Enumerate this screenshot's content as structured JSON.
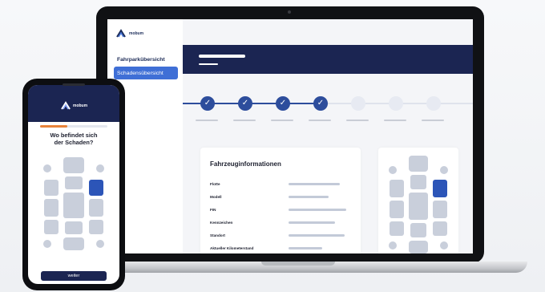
{
  "laptop": {
    "logo_text": "mobum",
    "sidebar": {
      "items": [
        {
          "label": "Fahrparkübersicht",
          "active": false
        },
        {
          "label": "Schadensübersicht",
          "active": true
        }
      ]
    },
    "stepper": {
      "steps": [
        {
          "state": "done",
          "glyph": "✓"
        },
        {
          "state": "done",
          "glyph": "✓"
        },
        {
          "state": "done",
          "glyph": "✓"
        },
        {
          "state": "done",
          "glyph": "✓"
        },
        {
          "state": "todo",
          "glyph": ""
        },
        {
          "state": "todo",
          "glyph": ""
        },
        {
          "state": "todo",
          "glyph": ""
        }
      ]
    },
    "vehicle_card": {
      "title": "Fahrzeuginformationen",
      "fields": [
        {
          "label": "Flotte"
        },
        {
          "label": "Modell"
        },
        {
          "label": "FIN"
        },
        {
          "label": "Kennzeichen"
        },
        {
          "label": "Standort"
        },
        {
          "label": "Aktueller Kilometerstand"
        }
      ]
    }
  },
  "phone": {
    "logo_text": "mobum",
    "question": "Wo befindet sich\nder Schaden?",
    "button_label": "weiter",
    "progress_fraction": 0.4
  },
  "colors": {
    "navy": "#1b2552",
    "accent_blue": "#3f6fd6",
    "step_done": "#2d4d9c",
    "damage_highlight": "#2c55b8",
    "progress_orange": "#e8833a"
  },
  "icons": {
    "logo": "mobum-logo-icon",
    "check": "check-icon",
    "car": "car-diagram-icon"
  }
}
